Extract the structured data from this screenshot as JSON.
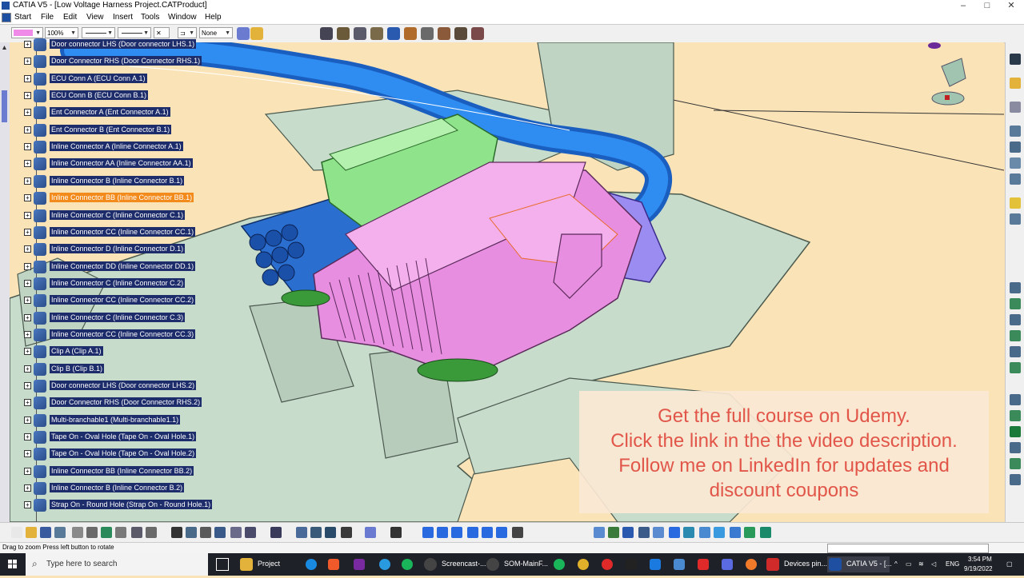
{
  "window": {
    "title": "CATIA V5 - [Low Voltage Harness Project.CATProduct]",
    "controls": [
      "–",
      "□",
      "✕"
    ]
  },
  "menu": {
    "items": [
      "Start",
      "File",
      "Edit",
      "View",
      "Insert",
      "Tools",
      "Window",
      "Help"
    ]
  },
  "graphic_props": {
    "color_value": "",
    "transparency": "100%",
    "layer": "None"
  },
  "tree": {
    "items": [
      {
        "label": "Door connector LHS (Door connector LHS.1)",
        "selected": false
      },
      {
        "label": "Door Connector RHS (Door Connector RHS.1)",
        "selected": false
      },
      {
        "label": "ECU Conn A (ECU Conn A.1)",
        "selected": false
      },
      {
        "label": "ECU Conn B (ECU Conn B.1)",
        "selected": false
      },
      {
        "label": "Ent Connector A (Ent Connector A.1)",
        "selected": false
      },
      {
        "label": "Ent Connector B (Ent Connector B.1)",
        "selected": false
      },
      {
        "label": "Inline Connector A (Inline Connector A.1)",
        "selected": false
      },
      {
        "label": "Inline Connector AA (Inline Connector AA.1)",
        "selected": false
      },
      {
        "label": "Inline Connector B (Inline Connector B.1)",
        "selected": false
      },
      {
        "label": "Inline Connector BB (Inline Connector BB.1)",
        "selected": true
      },
      {
        "label": "Inline Connector C (Inline Connector C.1)",
        "selected": false
      },
      {
        "label": "Inline Connector CC (Inline Connector CC.1)",
        "selected": false
      },
      {
        "label": "Inline Connector D (Inline Connector D.1)",
        "selected": false
      },
      {
        "label": "Inline Connector DD (Inline Connector DD.1)",
        "selected": false
      },
      {
        "label": "Inline Connector C (Inline Connector C.2)",
        "selected": false
      },
      {
        "label": "Inline Connector CC (Inline Connector CC.2)",
        "selected": false
      },
      {
        "label": "Inline Connector C (Inline Connector C.3)",
        "selected": false
      },
      {
        "label": "Inline Connector CC (Inline Connector CC.3)",
        "selected": false
      },
      {
        "label": "Clip A (Clip A.1)",
        "selected": false
      },
      {
        "label": "Clip B (Clip B.1)",
        "selected": false
      },
      {
        "label": "Door connector LHS (Door connector LHS.2)",
        "selected": false
      },
      {
        "label": "Door Connector RHS (Door Connector RHS.2)",
        "selected": false
      },
      {
        "label": "Multi-branchable1 (Multi-branchable1.1)",
        "selected": false
      },
      {
        "label": "Tape On - Oval Hole (Tape On - Oval Hole.1)",
        "selected": false
      },
      {
        "label": "Tape On - Oval Hole (Tape On - Oval Hole.2)",
        "selected": false
      },
      {
        "label": "Inline Connector BB (Inline Connector BB.2)",
        "selected": false
      },
      {
        "label": "Inline Connector B (Inline Connector B.2)",
        "selected": false
      },
      {
        "label": "Strap On - Round Hole (Strap On - Round Hole.1)",
        "selected": false
      }
    ]
  },
  "promo": {
    "lines": [
      "Get the full course on Udemy.",
      "Click the link in the the video description.",
      "Follow me on LinkedIn for updates and",
      "discount coupons"
    ]
  },
  "status": {
    "message": "Drag to zoom  Press left button to rotate"
  },
  "taskbar": {
    "search_placeholder": "Type here to search",
    "apps": [
      {
        "label": "Project",
        "icon": "folder-icon"
      },
      {
        "label": "Screencast-...",
        "icon": "screencast-icon"
      },
      {
        "label": "SOM-MainF...",
        "icon": "app-icon"
      },
      {
        "label": "Devices pin...",
        "icon": "pdf-icon"
      },
      {
        "label": "CATIA V5 - [...",
        "icon": "catia-icon"
      }
    ],
    "lang": "ENG",
    "time": "3:54 PM",
    "date": "9/19/2022"
  },
  "colors": {
    "background": "#fbe3b8",
    "tree_label_bg": "#1d2c6a",
    "tree_selected_bg": "#f28a1c",
    "harness_blue": "#1a78e0",
    "connector_pink": "#e88ee0",
    "connector_green": "#8fe38a",
    "plate_grey": "#c8dccc",
    "promo_text": "#e2564a"
  }
}
